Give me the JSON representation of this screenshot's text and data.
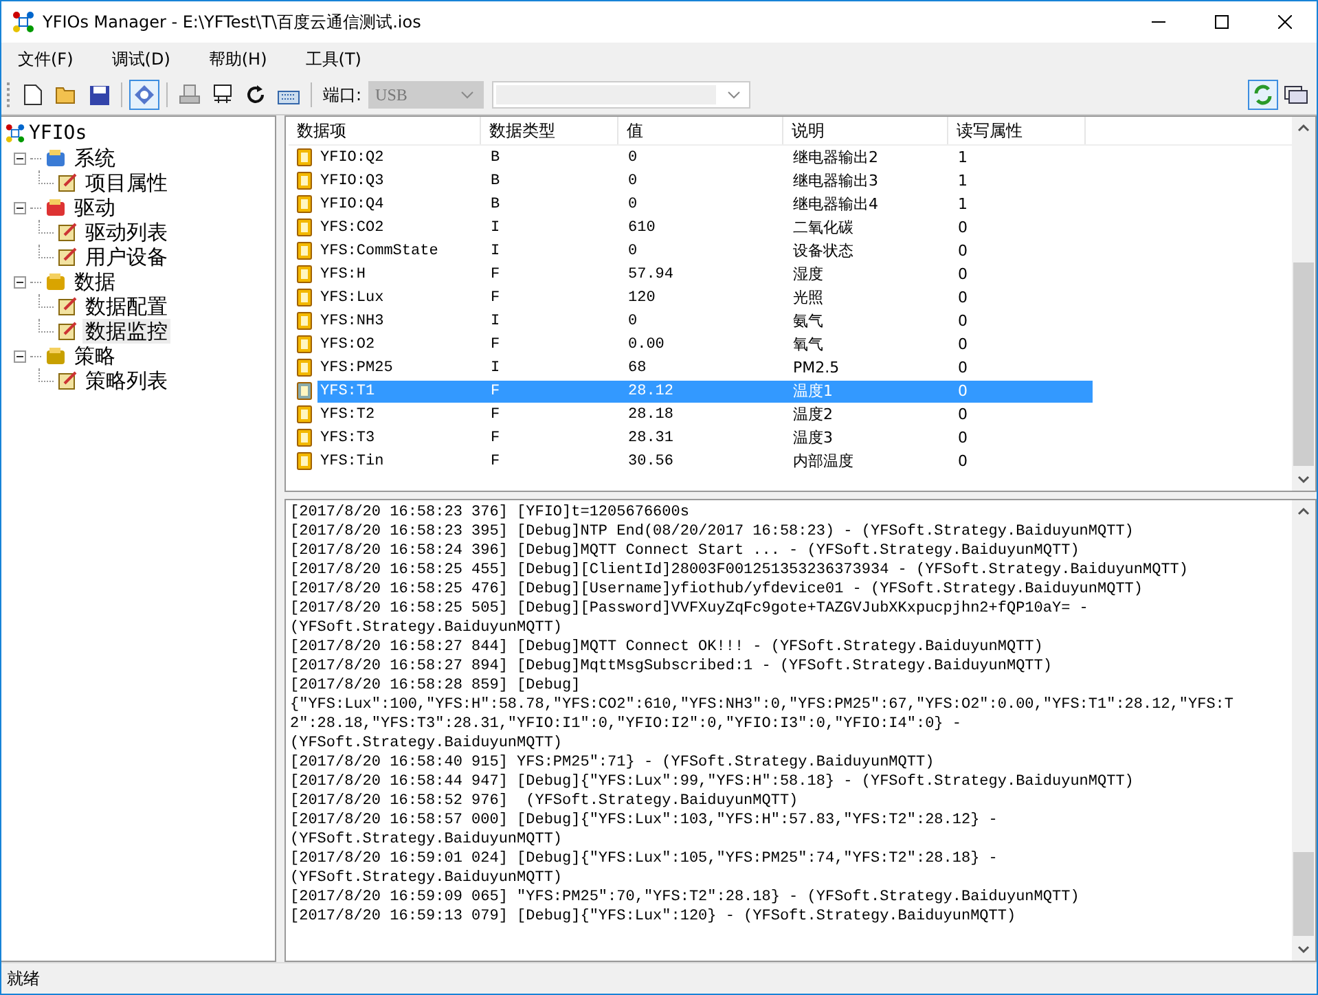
{
  "window": {
    "title": "YFIOs Manager - E:\\YFTest\\T\\百度云通信测试.ios"
  },
  "menu": [
    "文件(F)",
    "调试(D)",
    "帮助(H)",
    "工具(T)"
  ],
  "toolbar": {
    "buttons": [
      {
        "kind": "new",
        "selected": false
      },
      {
        "kind": "open",
        "selected": false
      },
      {
        "kind": "save",
        "selected": false
      },
      {
        "kind": "info",
        "selected": true
      },
      {
        "kind": "print",
        "selected": false
      },
      {
        "kind": "device",
        "selected": false
      },
      {
        "kind": "refresh",
        "selected": false
      },
      {
        "kind": "keyboard",
        "selected": false
      }
    ],
    "port_label": "端口:",
    "port_value": "USB",
    "port_disabled": true,
    "right_buttons": [
      {
        "kind": "sync",
        "selected": true
      },
      {
        "kind": "folders",
        "selected": false
      }
    ]
  },
  "tree": {
    "label": "YFIOs",
    "children": [
      {
        "label": "系统",
        "expanded": true,
        "selected": false,
        "children": [
          {
            "label": "项目属性",
            "selected": false
          }
        ]
      },
      {
        "label": "驱动",
        "expanded": true,
        "selected": false,
        "children": [
          {
            "label": "驱动列表",
            "selected": false
          },
          {
            "label": "用户设备",
            "selected": false
          }
        ]
      },
      {
        "label": "数据",
        "expanded": true,
        "selected": false,
        "children": [
          {
            "label": "数据配置",
            "selected": false
          },
          {
            "label": "数据监控",
            "selected": true
          }
        ]
      },
      {
        "label": "策略",
        "expanded": true,
        "selected": false,
        "children": [
          {
            "label": "策略列表",
            "selected": false
          }
        ]
      }
    ]
  },
  "table": {
    "columns": [
      "数据项",
      "数据类型",
      "值",
      "说明",
      "读写属性"
    ],
    "rows": [
      {
        "cells": [
          "YFIO:Q2",
          "B",
          "0",
          "继电器输出2",
          "1"
        ],
        "selected": false
      },
      {
        "cells": [
          "YFIO:Q3",
          "B",
          "0",
          "继电器输出3",
          "1"
        ],
        "selected": false
      },
      {
        "cells": [
          "YFIO:Q4",
          "B",
          "0",
          "继电器输出4",
          "1"
        ],
        "selected": false
      },
      {
        "cells": [
          "YFS:CO2",
          "I",
          "610",
          "二氧化碳",
          "0"
        ],
        "selected": false
      },
      {
        "cells": [
          "YFS:CommState",
          "I",
          "0",
          "设备状态",
          "0"
        ],
        "selected": false
      },
      {
        "cells": [
          "YFS:H",
          "F",
          "57.94",
          "湿度",
          "0"
        ],
        "selected": false
      },
      {
        "cells": [
          "YFS:Lux",
          "F",
          "120",
          "光照",
          "0"
        ],
        "selected": false
      },
      {
        "cells": [
          "YFS:NH3",
          "I",
          "0",
          "氨气",
          "0"
        ],
        "selected": false
      },
      {
        "cells": [
          "YFS:O2",
          "F",
          "0.00",
          "氧气",
          "0"
        ],
        "selected": false
      },
      {
        "cells": [
          "YFS:PM25",
          "I",
          "68",
          "PM2.5",
          "0"
        ],
        "selected": false
      },
      {
        "cells": [
          "YFS:T1",
          "F",
          "28.12",
          "温度1",
          "0"
        ],
        "selected": true
      },
      {
        "cells": [
          "YFS:T2",
          "F",
          "28.18",
          "温度2",
          "0"
        ],
        "selected": false
      },
      {
        "cells": [
          "YFS:T3",
          "F",
          "28.31",
          "温度3",
          "0"
        ],
        "selected": false
      },
      {
        "cells": [
          "YFS:Tin",
          "F",
          "30.56",
          "内部温度",
          "0"
        ],
        "selected": false
      }
    ]
  },
  "log": [
    "[2017/8/20 16:58:23 376] [YFIO]t=1205676600s",
    "[2017/8/20 16:58:23 395] [Debug]NTP End(08/20/2017 16:58:23) - (YFSoft.Strategy.BaiduyunMQTT)",
    "[2017/8/20 16:58:24 396] [Debug]MQTT Connect Start ... - (YFSoft.Strategy.BaiduyunMQTT)",
    "[2017/8/20 16:58:25 455] [Debug][ClientId]28003F001251353236373934 - (YFSoft.Strategy.BaiduyunMQTT)",
    "[2017/8/20 16:58:25 476] [Debug][Username]yfiothub/yfdevice01 - (YFSoft.Strategy.BaiduyunMQTT)",
    "[2017/8/20 16:58:25 505] [Debug][Password]VVFXuyZqFc9gote+TAZGVJubXKxpucpjhn2+fQP10aY= -",
    "(YFSoft.Strategy.BaiduyunMQTT)",
    "[2017/8/20 16:58:27 844] [Debug]MQTT Connect OK!!! - (YFSoft.Strategy.BaiduyunMQTT)",
    "[2017/8/20 16:58:27 894] [Debug]MqttMsgSubscribed:1 - (YFSoft.Strategy.BaiduyunMQTT)",
    "[2017/8/20 16:58:28 859] [Debug]",
    "{\"YFS:Lux\":100,\"YFS:H\":58.78,\"YFS:CO2\":610,\"YFS:NH3\":0,\"YFS:PM25\":67,\"YFS:O2\":0.00,\"YFS:T1\":28.12,\"YFS:T",
    "2\":28.18,\"YFS:T3\":28.31,\"YFIO:I1\":0,\"YFIO:I2\":0,\"YFIO:I3\":0,\"YFIO:I4\":0} -",
    "(YFSoft.Strategy.BaiduyunMQTT)",
    "[2017/8/20 16:58:40 915] YFS:PM25\":71} - (YFSoft.Strategy.BaiduyunMQTT)",
    "[2017/8/20 16:58:44 947] [Debug]{\"YFS:Lux\":99,\"YFS:H\":58.18} - (YFSoft.Strategy.BaiduyunMQTT)",
    "[2017/8/20 16:58:52 976]  (YFSoft.Strategy.BaiduyunMQTT)",
    "[2017/8/20 16:58:57 000] [Debug]{\"YFS:Lux\":103,\"YFS:H\":57.83,\"YFS:T2\":28.12} -",
    "(YFSoft.Strategy.BaiduyunMQTT)",
    "[2017/8/20 16:59:01 024] [Debug]{\"YFS:Lux\":105,\"YFS:PM25\":74,\"YFS:T2\":28.18} -",
    "(YFSoft.Strategy.BaiduyunMQTT)",
    "[2017/8/20 16:59:09 065] \"YFS:PM25\":70,\"YFS:T2\":28.18} - (YFSoft.Strategy.BaiduyunMQTT)",
    "[2017/8/20 16:59:13 079] [Debug]{\"YFS:Lux\":120} - (YFSoft.Strategy.BaiduyunMQTT)"
  ],
  "status_bar": "就绪"
}
